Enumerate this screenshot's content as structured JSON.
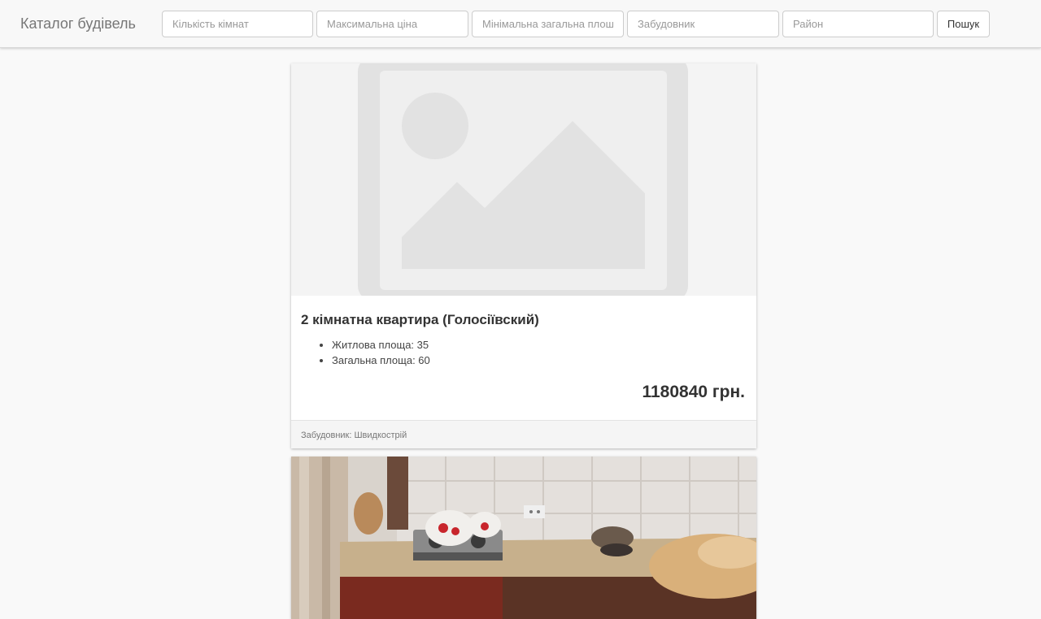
{
  "navbar": {
    "brand": "Каталог будівель",
    "filters": {
      "rooms_placeholder": "Кількість кімнат",
      "max_price_placeholder": "Максимальна ціна",
      "min_area_placeholder": "Мінімальна загальна площа",
      "developer_placeholder": "Забудовник",
      "district_placeholder": "Район"
    },
    "search_label": "Пошук"
  },
  "listings": [
    {
      "image": "image-placeholder-icon",
      "title": "2 кімнатна квартира (Голосіївский)",
      "features": [
        "Житлова площа: 35",
        "Загальна площа: 60"
      ],
      "price": "1180840 грн.",
      "footer": "Забудовник: Швидкострій"
    },
    {
      "image": "kitchen-photo"
    }
  ]
}
